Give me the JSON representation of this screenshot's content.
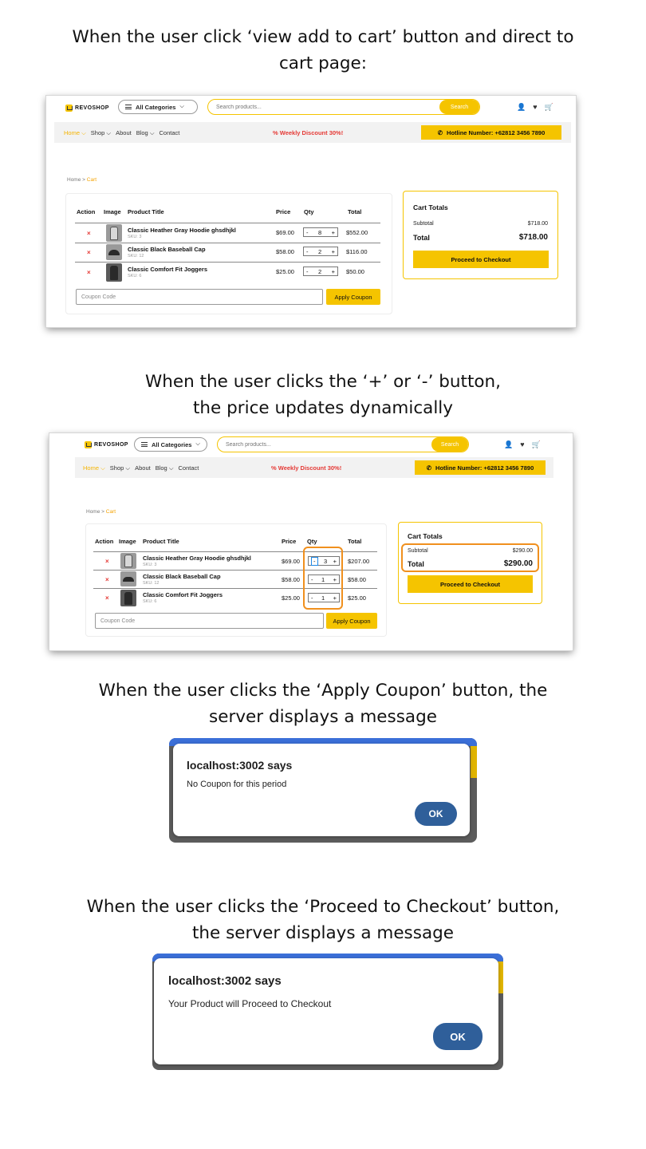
{
  "captions": {
    "c1_l1": "When the user click ‘view add to cart’ button and direct to",
    "c1_l2": "cart page:",
    "c2_l1": "When the user clicks the ‘+’ or ‘-’ button,",
    "c2_l2": "the price updates dynamically",
    "c3_l1": "When the user clicks the ‘Apply Coupon’ button, the",
    "c3_l2": "server displays a message",
    "c4_l1": "When the user clicks the ‘Proceed to Checkout’ button,",
    "c4_l2": "the server displays a message"
  },
  "site": {
    "logo": "REVOSHOP",
    "categories": "All Categories",
    "search_placeholder": "Search products...",
    "search_btn": "Search",
    "nav": {
      "home": "Home",
      "shop": "Shop",
      "about": "About",
      "blog": "Blog",
      "contact": "Contact"
    },
    "promo": "% Weekly Discount 30%!",
    "hotline": "Hotline Number: +62812 3456 7890",
    "crumb_home": "Home",
    "crumb_sep": " > ",
    "crumb_cur": "Cart",
    "headers": {
      "action": "Action",
      "image": "Image",
      "title": "Product Title",
      "price": "Price",
      "qty": "Qty",
      "total": "Total"
    },
    "remove": "×",
    "coupon_placeholder": "Coupon Code",
    "apply_coupon": "Apply Coupon",
    "cart_totals": "Cart Totals",
    "subtotal_label": "Subtotal",
    "total_label": "Total",
    "checkout": "Proceed to Checkout",
    "minus": "-",
    "plus": "+"
  },
  "shot1": {
    "rows": [
      {
        "name": "Classic Heather Gray Hoodie ghsdhjkl",
        "sku": "SKU: 3",
        "price": "$69.00",
        "qty": "8",
        "total": "$552.00"
      },
      {
        "name": "Classic Black Baseball Cap",
        "sku": "SKU: 12",
        "price": "$58.00",
        "qty": "2",
        "total": "$116.00"
      },
      {
        "name": "Classic Comfort Fit Joggers",
        "sku": "SKU: 6",
        "price": "$25.00",
        "qty": "2",
        "total": "$50.00"
      }
    ],
    "subtotal": "$718.00",
    "total": "$718.00"
  },
  "shot2": {
    "rows": [
      {
        "name": "Classic Heather Gray Hoodie ghsdhjkl",
        "sku": "SKU: 3",
        "price": "$69.00",
        "qty": "3",
        "total": "$207.00"
      },
      {
        "name": "Classic Black Baseball Cap",
        "sku": "SKU: 12",
        "price": "$58.00",
        "qty": "1",
        "total": "$58.00"
      },
      {
        "name": "Classic Comfort Fit Joggers",
        "sku": "SKU: 6",
        "price": "$25.00",
        "qty": "1",
        "total": "$25.00"
      }
    ],
    "subtotal": "$290.00",
    "total": "$290.00"
  },
  "dialog1": {
    "title": "localhost:3002 says",
    "message": "No Coupon for this period",
    "ok": "OK"
  },
  "dialog2": {
    "title": "localhost:3002 says",
    "message": "Your Product will Proceed to Checkout",
    "ok": "OK"
  }
}
